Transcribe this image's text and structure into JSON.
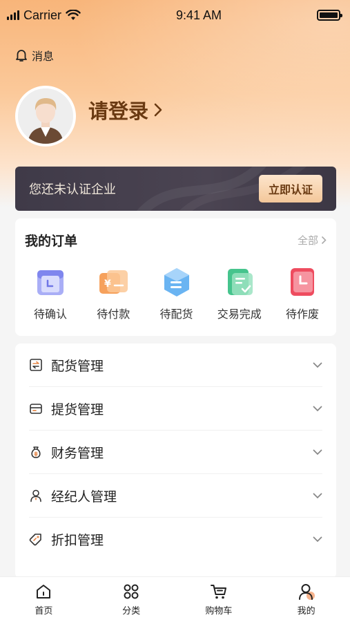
{
  "status_bar": {
    "carrier": "Carrier",
    "time": "9:41 AM"
  },
  "header": {
    "messages_label": "消息",
    "login_label": "请登录"
  },
  "certification": {
    "text": "您还未认证企业",
    "button_label": "立即认证"
  },
  "orders": {
    "title": "我的订单",
    "view_all_label": "全部",
    "items": [
      {
        "label": "待确认",
        "icon": "pending-confirm-icon",
        "color": "#8f96f2"
      },
      {
        "label": "待付款",
        "icon": "pending-payment-icon",
        "color": "#f7a25a"
      },
      {
        "label": "待配货",
        "icon": "pending-allocation-icon",
        "color": "#58a8ee"
      },
      {
        "label": "交易完成",
        "icon": "transaction-complete-icon",
        "color": "#3fc289"
      },
      {
        "label": "待作废",
        "icon": "pending-void-icon",
        "color": "#ee4c5f"
      }
    ]
  },
  "menu": {
    "items": [
      {
        "label": "配货管理",
        "icon": "allocation-icon"
      },
      {
        "label": "提货管理",
        "icon": "pickup-icon"
      },
      {
        "label": "财务管理",
        "icon": "finance-icon"
      },
      {
        "label": "经纪人管理",
        "icon": "agent-icon"
      },
      {
        "label": "折扣管理",
        "icon": "discount-icon"
      }
    ]
  },
  "tabbar": {
    "items": [
      {
        "label": "首页",
        "icon": "home-icon"
      },
      {
        "label": "分类",
        "icon": "category-icon"
      },
      {
        "label": "购物车",
        "icon": "cart-icon"
      },
      {
        "label": "我的",
        "icon": "profile-icon",
        "active": true
      }
    ]
  },
  "colors": {
    "accent": "#f8b57a",
    "brand_text": "#6a3a12",
    "banner_bg": "#443e4c"
  }
}
